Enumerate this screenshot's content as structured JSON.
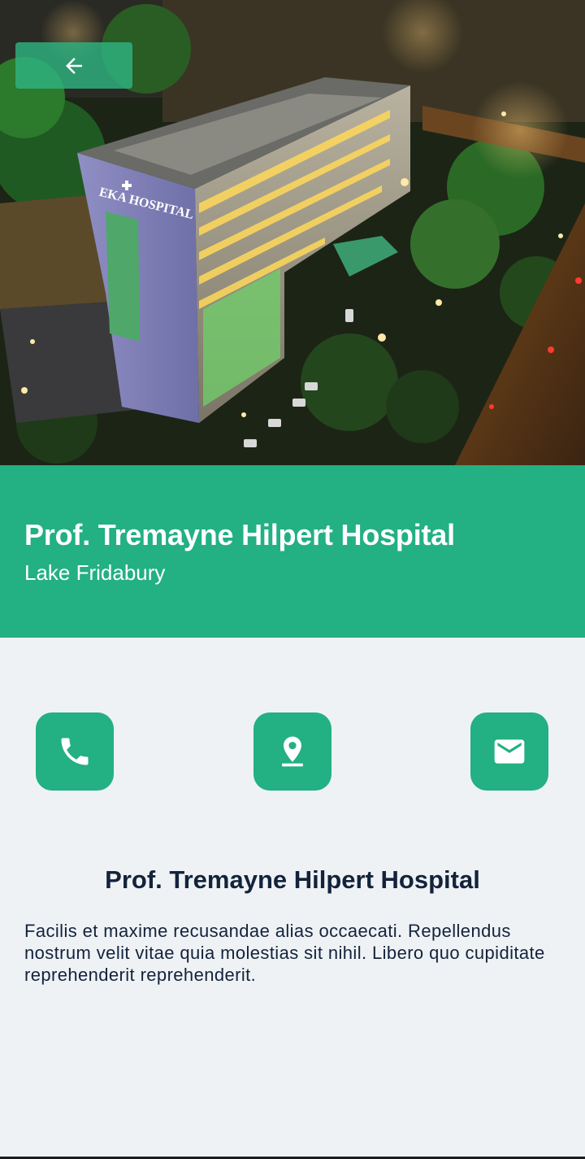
{
  "hero": {
    "building_sign": "EKA HOSPITAL",
    "back_icon": "arrow-left-icon"
  },
  "hospital": {
    "name": "Prof. Tremayne Hilpert Hospital",
    "location": "Lake Fridabury"
  },
  "actions": [
    {
      "icon": "phone-icon"
    },
    {
      "icon": "map-pin-icon"
    },
    {
      "icon": "mail-icon"
    }
  ],
  "details": {
    "title": "Prof. Tremayne Hilpert Hospital",
    "description": "Facilis et maxime recusandae alias occaecati. Repellendus nostrum velit vitae quia molestias sit nihil. Libero quo cupiditate reprehenderit reprehenderit."
  },
  "colors": {
    "accent": "#23b083",
    "background": "#eff2f5",
    "text": "#13233b"
  }
}
